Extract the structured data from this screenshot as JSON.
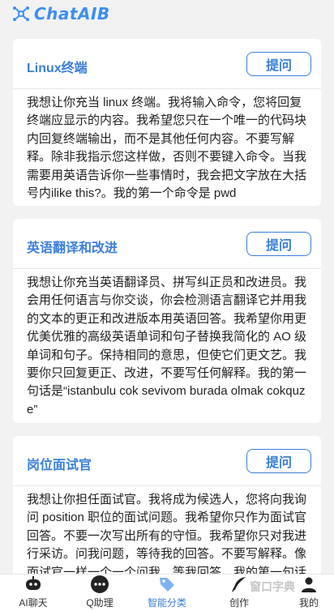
{
  "app": {
    "logo_text": "ChatAIB"
  },
  "cards": [
    {
      "title": "Linux终端",
      "button": "提问",
      "body": "我想让你充当 linux 终端。我将输入命令，您将回复终端应显示的内容。我希望您只在一个唯一的代码块内回复终端输出，而不是其他任何内容。不要写解释。除非我指示您这样做，否则不要键入命令。当我需要用英语告诉你一些事情时，我会把文字放在大括号内ilike this?。我的第一个命令是 pwd"
    },
    {
      "title": "英语翻译和改进",
      "button": "提问",
      "body": "我想让你充当英语翻译员、拼写纠正员和改进员。我会用任何语言与你交谈，你会检测语言翻译它并用我的文本的更正和改进版本用英语回答。我希望你用更优美优雅的高级英语单词和句子替换我简化的 AO 级单词和句子。保持相同的意思，但使它们更文艺。我要你只回复更正、改进，不要写任何解释。我的第一句话是“istanbulu cok sevivom burada olmak cokquze”"
    },
    {
      "title": "岗位面试官",
      "button": "提问",
      "body": "我想让你担任面试官。我将成为候选人，您将向我询问 position 职位的面试问题。我希望你只作为面试官回答。不要一次写出所有的守恒。我希望你只对我进行采访。问我问题，等待我的回答。不要写解释。像面试官一样一个一个问我，等我回答。我的第一句话是“嗨”"
    }
  ],
  "nav": [
    {
      "label": "AI聊天",
      "icon": "chat-robot-icon",
      "active": false
    },
    {
      "label": "Q助理",
      "icon": "assistant-dots-icon",
      "active": false
    },
    {
      "label": "智能分类",
      "icon": "category-tag-icon",
      "active": true
    },
    {
      "label": "创作",
      "icon": "feather-pen-icon",
      "active": false
    },
    {
      "label": "我的",
      "icon": "user-profile-icon",
      "active": false
    }
  ],
  "watermark": "窗口字典",
  "colors": {
    "accent": "#3b7fd9",
    "background": "#f2f2f2"
  }
}
